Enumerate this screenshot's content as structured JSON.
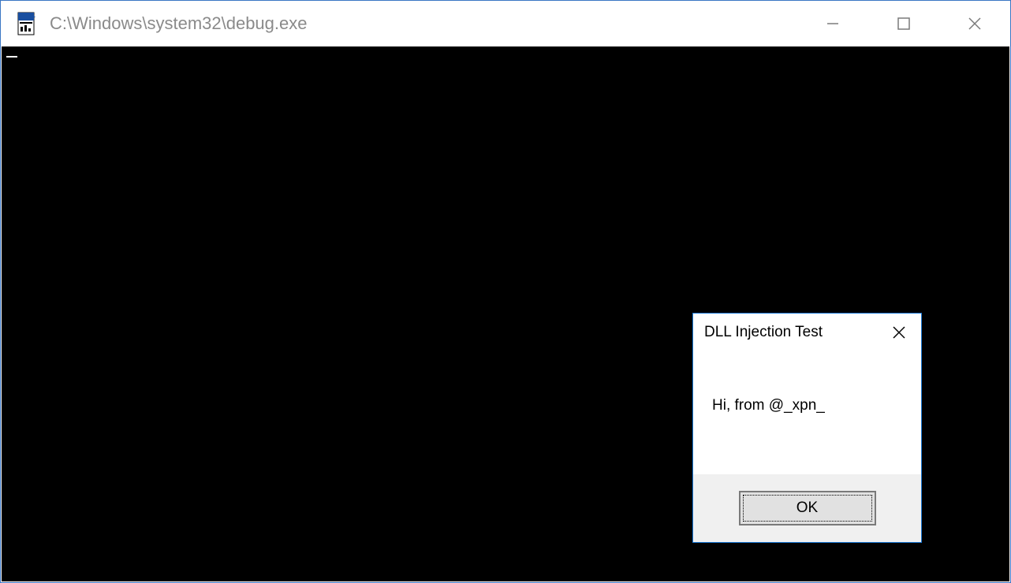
{
  "main_window": {
    "title": "C:\\Windows\\system32\\debug.exe",
    "console_content": "_",
    "controls": {
      "minimize": "minimize",
      "maximize": "maximize",
      "close": "close"
    }
  },
  "dialog": {
    "title": "DLL Injection Test",
    "message": "Hi, from @_xpn_",
    "ok_label": "OK",
    "close": "close"
  }
}
